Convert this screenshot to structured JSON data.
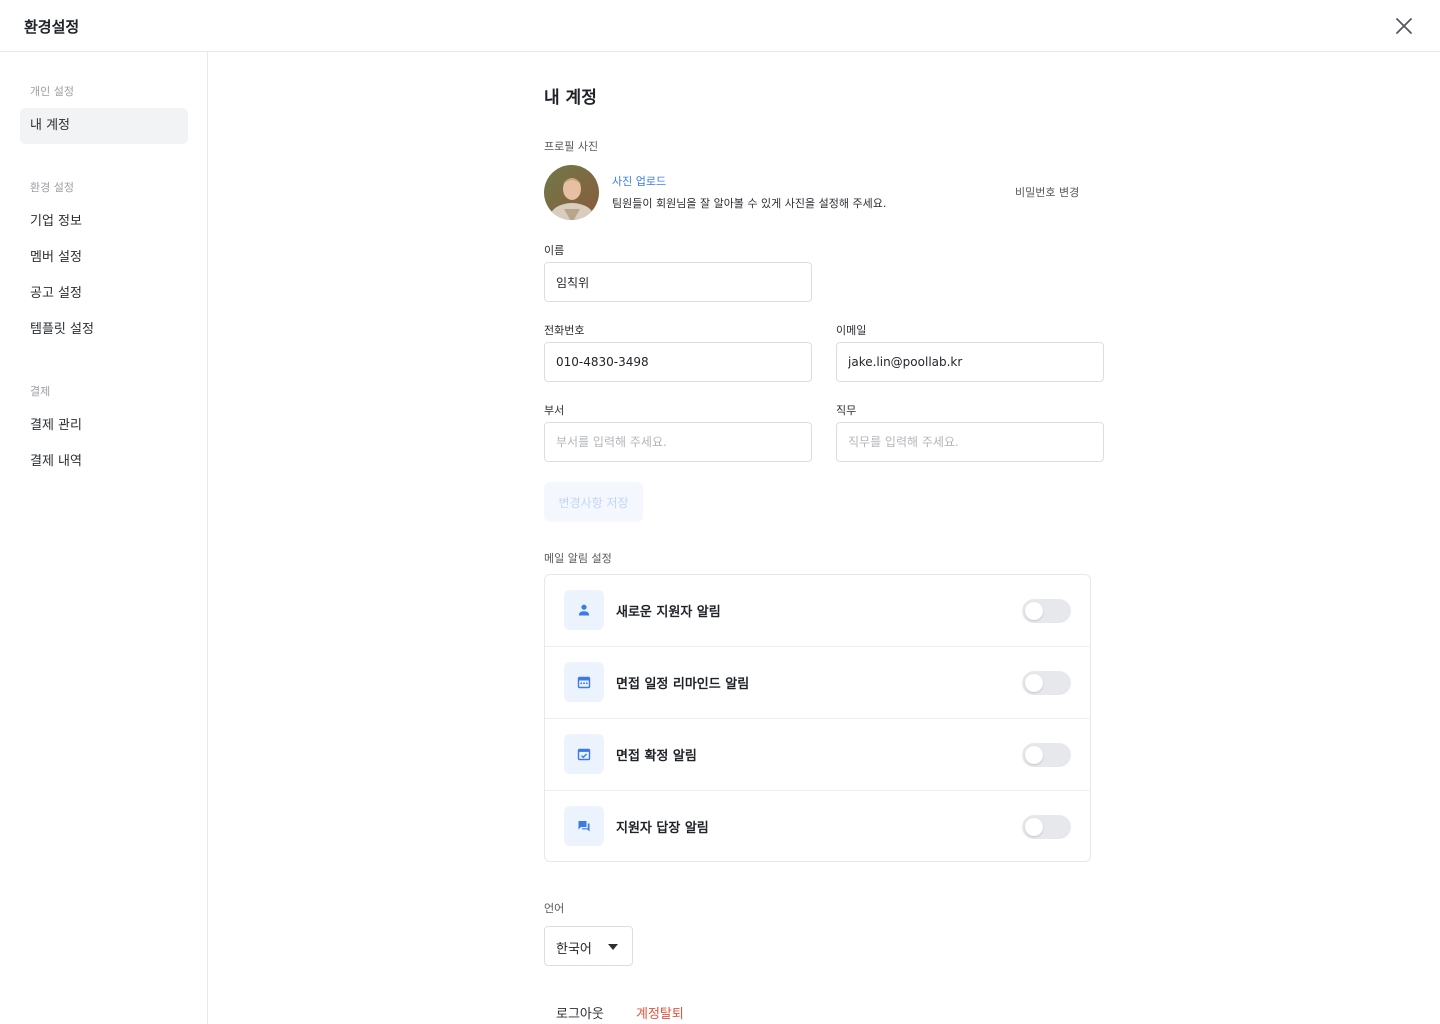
{
  "header": {
    "title": "환경설정"
  },
  "sidebar": {
    "groups": [
      {
        "title": "개인 설정",
        "items": [
          {
            "label": "내 계정"
          }
        ]
      },
      {
        "title": "환경 설정",
        "items": [
          {
            "label": "기업 정보"
          },
          {
            "label": "멤버 설정"
          },
          {
            "label": "공고 설정"
          },
          {
            "label": "템플릿 설정"
          }
        ]
      },
      {
        "title": "결제",
        "items": [
          {
            "label": "결제 관리"
          },
          {
            "label": "결제 내역"
          }
        ]
      }
    ],
    "active_item": "내 계정"
  },
  "main": {
    "title": "내 계정",
    "profile": {
      "label": "프로필 사진",
      "upload_label": "사진 업로드",
      "description": "팀원들이 회원님을 잘 알아볼 수 있게 사진을 설정해 주세요.",
      "password_change": "비밀번호 변경"
    },
    "fields": {
      "name": {
        "label": "이름",
        "value": "임칙위"
      },
      "phone": {
        "label": "전화번호",
        "value": "010-4830-3498"
      },
      "email": {
        "label": "이메일",
        "value": "jake.lin@poollab.kr"
      },
      "department": {
        "label": "부서",
        "placeholder": "부서를 입력해 주세요."
      },
      "job": {
        "label": "직무",
        "placeholder": "직무를 입력해 주세요."
      }
    },
    "save_label": "변경사항 저장",
    "notifications": {
      "label": "메일 알림 설정",
      "items": [
        {
          "label": "새로운 지원자 알림",
          "icon": "person-icon",
          "enabled": false
        },
        {
          "label": "면접 일정 리마인드 알림",
          "icon": "calendar-icon",
          "enabled": false
        },
        {
          "label": "면접 확정 알림",
          "icon": "calendar-check-icon",
          "enabled": false
        },
        {
          "label": "지원자 답장 알림",
          "icon": "chat-icon",
          "enabled": false
        }
      ]
    },
    "language": {
      "label": "언어",
      "value": "한국어"
    },
    "logout_label": "로그아웃",
    "withdraw_label": "계정탈퇴"
  },
  "colors": {
    "accent": "#3b7be8",
    "danger": "#e5533d",
    "icon_bg": "#edf3fd",
    "toggle_off": "#e6e8ec"
  }
}
